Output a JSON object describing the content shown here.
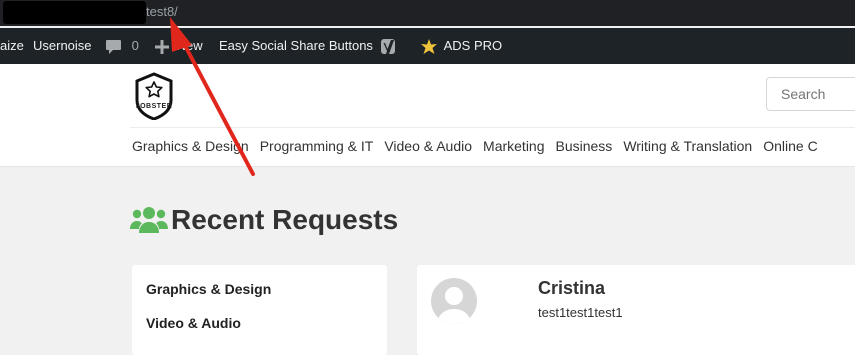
{
  "browser": {
    "url_text": "test8/"
  },
  "admin_bar": {
    "items": [
      {
        "label": "aize"
      },
      {
        "label": "Usernoise"
      },
      {
        "label": "0"
      },
      {
        "label": "New"
      },
      {
        "label": "Easy Social Share Buttons"
      },
      {
        "label": "ADS PRO"
      }
    ]
  },
  "header": {
    "logo_text": "JOBSTER",
    "search_placeholder": "Search",
    "categories": [
      "Graphics & Design",
      "Programming & IT",
      "Video & Audio",
      "Marketing",
      "Business",
      "Writing & Translation",
      "Online C"
    ]
  },
  "page": {
    "title": "Recent Requests",
    "title_icon": "users-icon",
    "sidebar_categories": [
      "Graphics & Design",
      "Video & Audio"
    ]
  },
  "request": {
    "name": "Cristina",
    "description": "test1test1test1"
  },
  "colors": {
    "accent_green": "#5cb85c",
    "annotation_red": "#e1261c",
    "admin_bar": "#1d2327"
  }
}
